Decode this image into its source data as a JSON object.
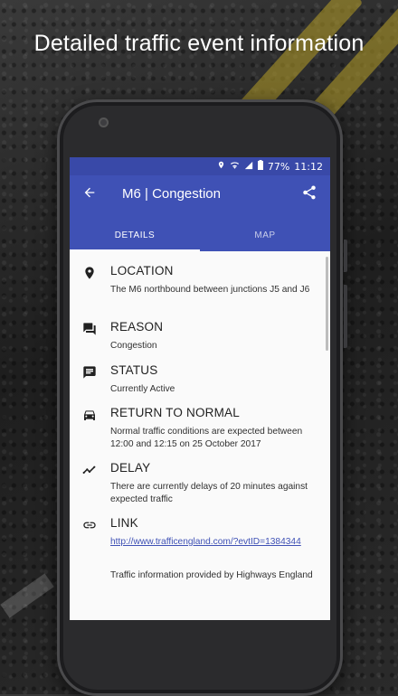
{
  "headline": "Detailed traffic event information",
  "status_bar": {
    "battery": "77%",
    "time": "11:12"
  },
  "app_bar": {
    "title": "M6 | Congestion"
  },
  "tabs": [
    {
      "label": "DETAILS",
      "active": true
    },
    {
      "label": "MAP",
      "active": false
    }
  ],
  "sections": [
    {
      "icon": "location-pin-icon",
      "heading": "LOCATION",
      "text": "The M6 northbound between junctions J5 and J6"
    },
    {
      "icon": "reason-chat-icon",
      "heading": "REASON",
      "text": "Congestion"
    },
    {
      "icon": "status-message-icon",
      "heading": "STATUS",
      "text": "Currently Active"
    },
    {
      "icon": "car-icon",
      "heading": "RETURN TO NORMAL",
      "text": "Normal traffic conditions are expected between 12:00 and 12:15 on 25 October 2017"
    },
    {
      "icon": "trending-line-icon",
      "heading": "DELAY",
      "text": "There are currently delays of 20 minutes against expected traffic"
    },
    {
      "icon": "link-icon",
      "heading": "LINK",
      "text": "http://www.trafficengland.com/?evtID=1384344"
    }
  ],
  "attribution": "Traffic information provided by Highways England",
  "colors": {
    "primary": "#3f51b5",
    "status_bar": "#3949a8",
    "road_stripe": "#b8a128"
  }
}
